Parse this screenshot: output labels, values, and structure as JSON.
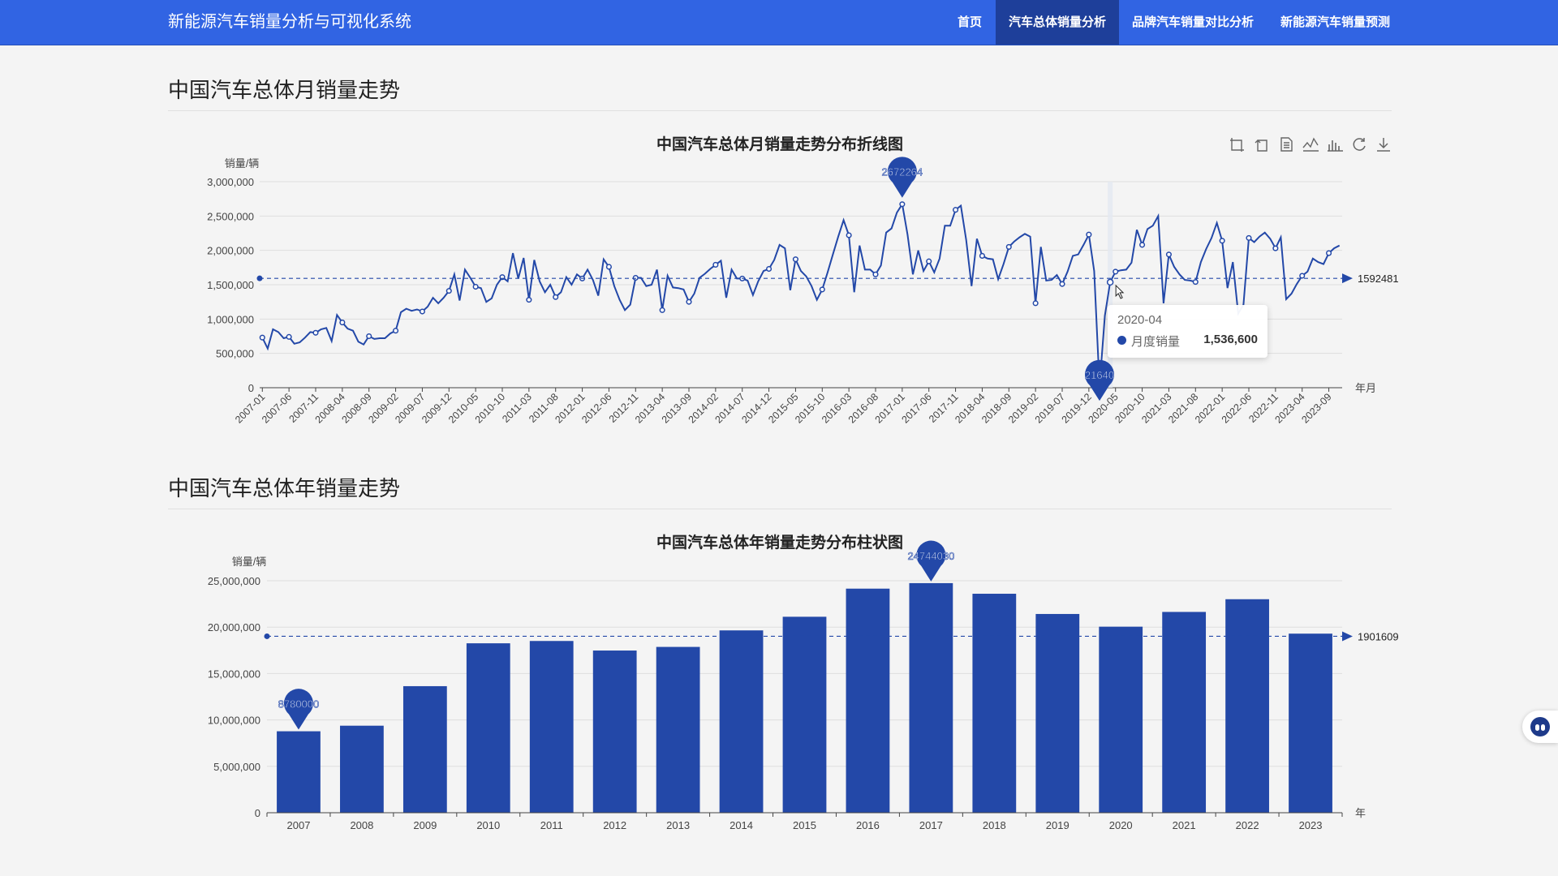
{
  "navbar": {
    "brand": "新能源汽车销量分析与可视化系统",
    "items": [
      {
        "label": "首页",
        "active": false
      },
      {
        "label": "汽车总体销量分析",
        "active": true
      },
      {
        "label": "品牌汽车销量对比分析",
        "active": false
      },
      {
        "label": "新能源汽车销量预测",
        "active": false
      }
    ]
  },
  "sections": {
    "monthly_heading": "中国汽车总体月销量走势",
    "yearly_heading": "中国汽车总体年销量走势"
  },
  "tooltip": {
    "date": "2020-04",
    "series_name": "月度销量",
    "value": "1,536,600"
  },
  "colors": {
    "primary": "#3164e3",
    "nav_active": "#1e3f9a",
    "series": "#2348a8"
  },
  "chart_data": [
    {
      "type": "line",
      "title": "中国汽车总体月销量走势分布折线图",
      "ylabel": "销量/辆",
      "xlabel": "年月",
      "ylim": [
        0,
        3000000
      ],
      "yticks": [
        "0",
        "500,000",
        "1,000,000",
        "1,500,000",
        "2,000,000",
        "2,500,000",
        "3,000,000"
      ],
      "xtick_labels": [
        "2007-01",
        "2007-06",
        "2007-11",
        "2008-04",
        "2008-09",
        "2009-02",
        "2009-07",
        "2009-12",
        "2010-05",
        "2010-10",
        "2011-03",
        "2011-08",
        "2012-01",
        "2012-06",
        "2012-11",
        "2013-04",
        "2013-09",
        "2014-02",
        "2014-07",
        "2014-12",
        "2015-05",
        "2015-10",
        "2016-03",
        "2016-08",
        "2017-01",
        "2017-06",
        "2017-11",
        "2018-04",
        "2018-09",
        "2019-02",
        "2019-07",
        "2019-12",
        "2020-05",
        "2020-10",
        "2021-03",
        "2021-08",
        "2022-01",
        "2022-06",
        "2022-11",
        "2023-04",
        "2023-09"
      ],
      "series": [
        {
          "name": "月度销量",
          "start": "2007-01",
          "values": [
            730000,
            570000,
            850000,
            810000,
            720000,
            740000,
            640000,
            660000,
            730000,
            810000,
            800000,
            850000,
            870000,
            680000,
            1060000,
            950000,
            860000,
            830000,
            670000,
            630000,
            750000,
            710000,
            720000,
            720000,
            790000,
            830000,
            1100000,
            1150000,
            1120000,
            1140000,
            1110000,
            1180000,
            1310000,
            1230000,
            1310000,
            1410000,
            1650000,
            1270000,
            1720000,
            1600000,
            1470000,
            1450000,
            1250000,
            1300000,
            1500000,
            1610000,
            1550000,
            1960000,
            1590000,
            1890000,
            1280000,
            1860000,
            1550000,
            1390000,
            1500000,
            1320000,
            1390000,
            1610000,
            1500000,
            1650000,
            1590000,
            1720000,
            1570000,
            1340000,
            1870000,
            1760000,
            1480000,
            1280000,
            1130000,
            1210000,
            1600000,
            1600000,
            1480000,
            1500000,
            1720000,
            1130000,
            1630000,
            1460000,
            1450000,
            1430000,
            1250000,
            1370000,
            1600000,
            1660000,
            1730000,
            1790000,
            1850000,
            1310000,
            1720000,
            1590000,
            1590000,
            1560000,
            1350000,
            1550000,
            1700000,
            1730000,
            1860000,
            2080000,
            2030000,
            1420000,
            1870000,
            1700000,
            1620000,
            1480000,
            1280000,
            1430000,
            1680000,
            1940000,
            2200000,
            2440000,
            2220000,
            1390000,
            2070000,
            1720000,
            1720000,
            1650000,
            1780000,
            2260000,
            2320000,
            2550000,
            2672264,
            2230000,
            1650000,
            2000000,
            1700000,
            1840000,
            1680000,
            1880000,
            2360000,
            2360000,
            2590000,
            2650000,
            2150000,
            1480000,
            2170000,
            1920000,
            1880000,
            1870000,
            1580000,
            1800000,
            2050000,
            2130000,
            2190000,
            2240000,
            2200000,
            1230000,
            2050000,
            1560000,
            1570000,
            1640000,
            1510000,
            1690000,
            1920000,
            1940000,
            2080000,
            2230000,
            1700000,
            21640,
            1050000,
            1536600,
            1690000,
            1710000,
            1720000,
            1820000,
            2300000,
            2080000,
            2310000,
            2360000,
            2500000,
            1230000,
            1940000,
            1760000,
            1650000,
            1570000,
            1560000,
            1540000,
            1830000,
            2020000,
            2180000,
            2400000,
            2140000,
            1450000,
            1830000,
            1080000,
            1210000,
            2180000,
            2120000,
            2200000,
            2260000,
            2170000,
            2030000,
            2190000,
            1290000,
            1370000,
            1510000,
            1630000,
            1690000,
            1880000,
            1830000,
            1800000,
            1960000,
            2030000,
            2070000
          ]
        }
      ],
      "markpoints": [
        {
          "label": "2672264",
          "x": "2017-01"
        },
        {
          "label": "21640",
          "x": "2020-02"
        }
      ],
      "markline": {
        "label": "1592481",
        "value": 1592481
      }
    },
    {
      "type": "bar",
      "title": "中国汽车总体年销量走势分布柱状图",
      "ylabel": "销量/辆",
      "xlabel": "年",
      "ylim": [
        0,
        25000000
      ],
      "yticks": [
        "0",
        "5,000,000",
        "10,000,000",
        "15,000,000",
        "20,000,000",
        "25,000,000"
      ],
      "categories": [
        "2007",
        "2008",
        "2009",
        "2010",
        "2011",
        "2012",
        "2013",
        "2014",
        "2015",
        "2016",
        "2017",
        "2018",
        "2019",
        "2020",
        "2021",
        "2022",
        "2023"
      ],
      "series": [
        {
          "values": [
            8780000,
            9380000,
            13640000,
            18260000,
            18510000,
            17480000,
            17870000,
            19650000,
            21120000,
            24150000,
            24744030,
            23600000,
            21420000,
            20050000,
            21640000,
            23010000,
            19300000
          ]
        }
      ],
      "markpoints": [
        {
          "label": "24744030",
          "x": "2017"
        },
        {
          "label": "8780000",
          "x": "2007"
        }
      ],
      "markline": {
        "label": "1901609",
        "value": 19016090
      }
    }
  ]
}
